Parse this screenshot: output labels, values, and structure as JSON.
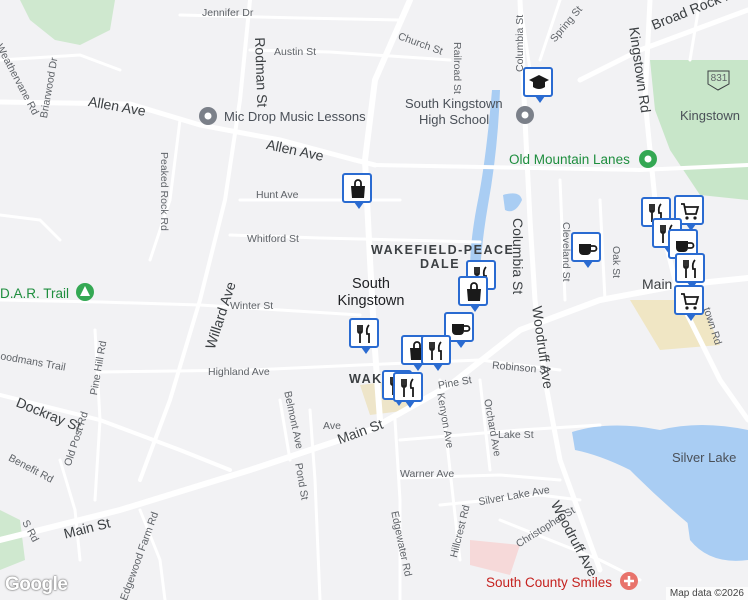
{
  "map": {
    "google_logo": "Google",
    "attribution": "Map data ©2026",
    "colors": {
      "water": "#a9cdf3",
      "park": "#c8e6c9",
      "pin_border": "#2a6bd1",
      "pin_icon": "#1a1a1a",
      "hospital": "#e8736b"
    },
    "streets": {
      "jennifer": "Jennifer Dr",
      "weathervane": "Weathervane Rd",
      "austin": "Austin St",
      "church": "Church St",
      "railroad": "Railroad St",
      "columbia_top": "Columbia St",
      "spring": "Spring St",
      "broad_rock": "Broad Rock Rd",
      "kingstown_rd": "Kingstown Rd",
      "rodman": "Rodman St",
      "allen_w": "Allen Ave",
      "allen_e": "Allen Ave",
      "briarwood": "Briarwood Dr",
      "peaked_rock": "Peaked Rock Rd",
      "hunt": "Hunt Ave",
      "whitford": "Whitford St",
      "winter": "Winter St",
      "willard": "Willard Ave",
      "columbia_mid": "Columbia St",
      "cleveland": "Cleveland St",
      "oak": "Oak St",
      "main_e": "Main",
      "woodruff_mid": "Woodruff Ave",
      "robinson": "Robinson St",
      "pine_st": "Pine St",
      "highland": "Highland Ave",
      "woodmans": "oodmans Trail",
      "pine_hill": "Pine Hill Rd",
      "belmont": "Belmont Ave",
      "kenyon": "Kenyon Ave",
      "orchard": "Orchard Ave",
      "dockray": "Dockray St",
      "main_st_mid": "Main St",
      "lake": "Lake St",
      "benefit": "Benefit Rd",
      "old_post": "Old Post Rd",
      "pond": "Pond St",
      "warner": "Warner Ave",
      "silver_lake_ave": "Silver Lake Ave",
      "main_st_w": "Main St",
      "s_rd": "S Rd",
      "edgewood": "Edgewood Farm Rd",
      "christopher": "Christopher St",
      "woodruff_s": "Woodruff Ave",
      "edgewater": "Edgewater Rd",
      "hillcrest": "Hillcrest Rd",
      "town_rd": "town Rd",
      "ave_fragment": "Ave",
      "kingstown_e": "Kingstown"
    },
    "places": {
      "mic_drop": "Mic Drop Music Lessons",
      "high_school_l1": "South Kingstown",
      "high_school_l2": "High School",
      "old_mountain": "Old Mountain Lanes",
      "dar_trail": "D.A.R. Trail",
      "south_county_smiles": "South County Smiles",
      "silver_lake": "Silver Lake",
      "wakefield_peace_dale_l1": "WAKEFIELD-PEACE",
      "wakefield_peace_dale_l2": "DALE",
      "town_l1": "South",
      "town_l2": "Kingstown",
      "wakefield_frag": "WAK",
      "route_831": "831"
    },
    "markers": [
      {
        "kind": "shopping-bag"
      },
      {
        "kind": "coffee"
      },
      {
        "kind": "restaurant"
      },
      {
        "kind": "shopping-cart"
      },
      {
        "kind": "restaurant"
      },
      {
        "kind": "coffee"
      },
      {
        "kind": "restaurant"
      },
      {
        "kind": "shopping-cart"
      },
      {
        "kind": "restaurant"
      },
      {
        "kind": "shopping-bag"
      },
      {
        "kind": "restaurant"
      },
      {
        "kind": "coffee"
      },
      {
        "kind": "shopping-bag"
      },
      {
        "kind": "restaurant"
      },
      {
        "kind": "restaurant"
      },
      {
        "kind": "restaurant"
      },
      {
        "kind": "school"
      }
    ]
  }
}
